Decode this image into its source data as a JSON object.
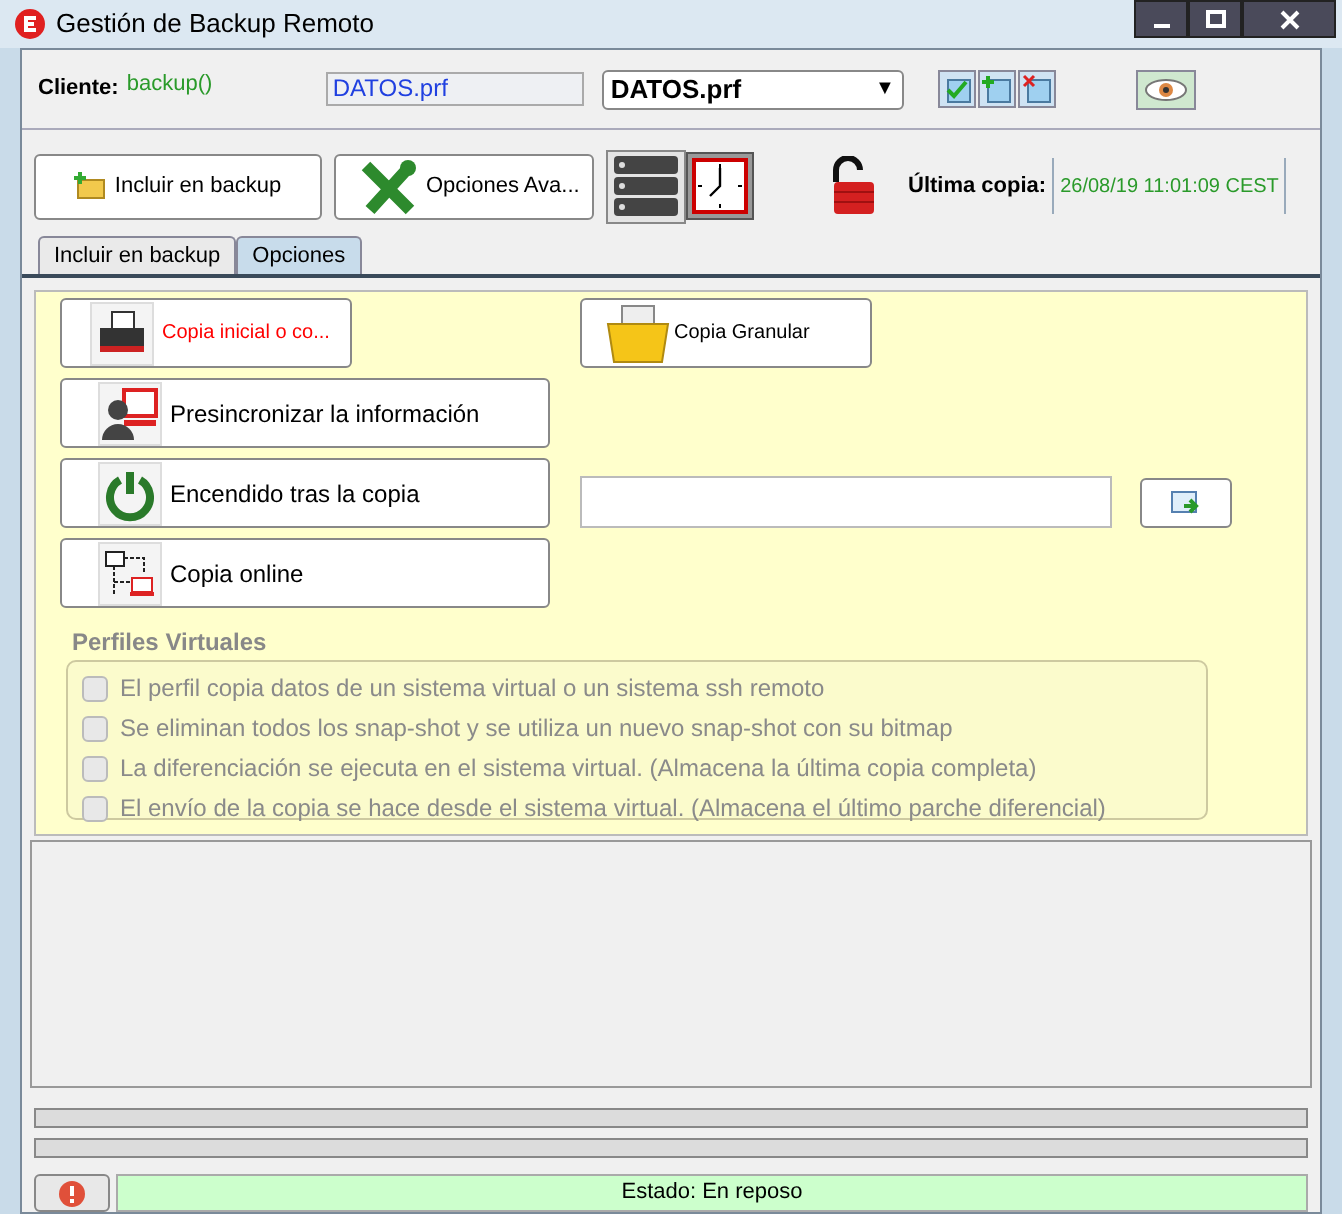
{
  "window": {
    "title": "Gestión de Backup Remoto"
  },
  "header": {
    "client_label": "Cliente:",
    "client_value": "backup()",
    "profile_field": "DATOS.prf",
    "profile_select": "DATOS.prf",
    "select_arrow": "▼"
  },
  "toolbar": {
    "buttons": [
      {
        "label": "Incluir en backup"
      },
      {
        "label": "Opciones Ava..."
      }
    ],
    "last_copy_label": "Última copia:",
    "last_copy_value": "26/08/19 11:01:09 CEST"
  },
  "tabs": [
    {
      "label": "Incluir en backup",
      "selected": false
    },
    {
      "label": "Opciones",
      "selected": true
    }
  ],
  "options": [
    {
      "label": "Copia inicial o co...",
      "highlighted": true
    },
    {
      "label": "Presincronizar la información",
      "highlighted": false
    },
    {
      "label": "Encendido tras la copia",
      "highlighted": false
    },
    {
      "label": "Copia online",
      "highlighted": false
    }
  ],
  "granular_button": {
    "label": "Copia Granular"
  },
  "virtual_profiles": {
    "title": "Perfiles Virtuales",
    "items": [
      {
        "label": "El perfil copia datos de un sistema virtual o un sistema ssh remoto",
        "checked": false,
        "disabled": true
      },
      {
        "label": "Se eliminan todos los snap-shot y se utiliza un nuevo snap-shot con su bitmap",
        "checked": false,
        "disabled": true
      },
      {
        "label": "La diferenciación se ejecuta en el sistema virtual. (Almacena la última copia completa)",
        "checked": false,
        "disabled": true
      },
      {
        "label": "El envío de la copia se hace desde el sistema virtual. (Almacena el último parche diferencial)",
        "checked": false,
        "disabled": true
      }
    ]
  },
  "progress_bars": [
    {
      "level": 0
    },
    {
      "level": 0
    }
  ],
  "status_bar": {
    "text": "Estado: En reposo"
  }
}
